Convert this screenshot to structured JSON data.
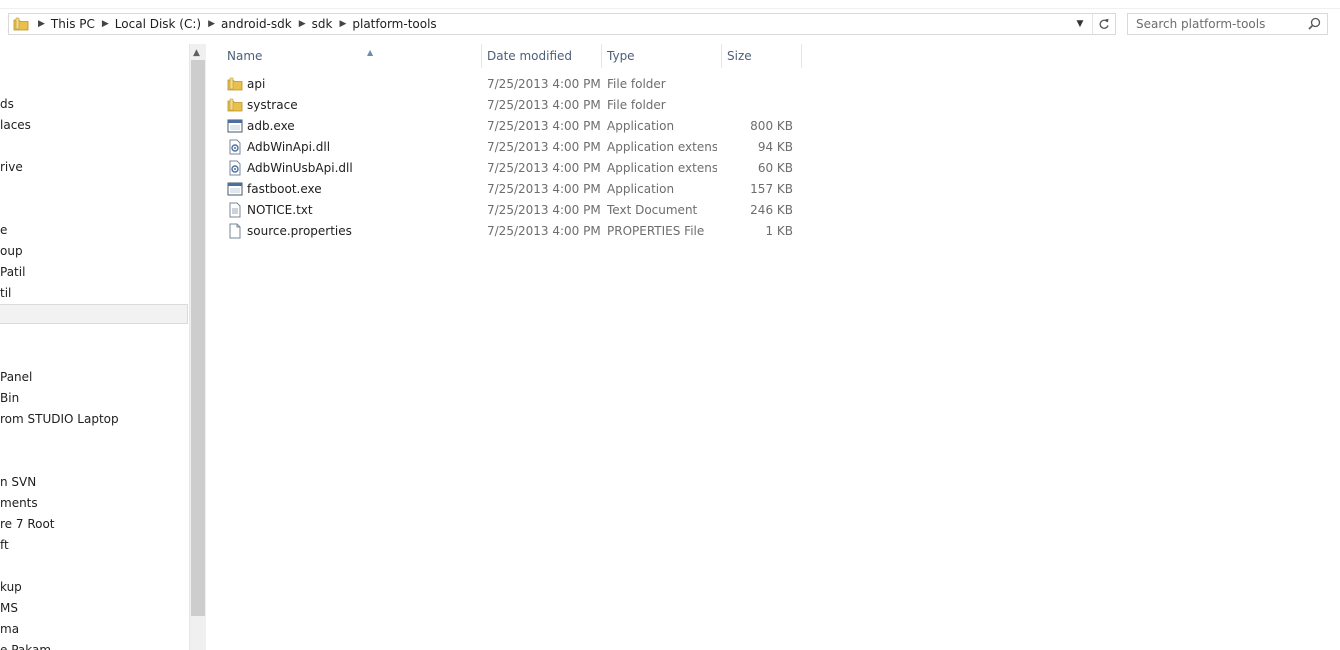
{
  "address_bar": {
    "crumbs": [
      "This PC",
      "Local Disk (C:)",
      "android-sdk",
      "sdk",
      "platform-tools"
    ]
  },
  "search": {
    "placeholder": "Search platform-tools"
  },
  "nav_pane": {
    "items": [
      "ds",
      "laces",
      "rive",
      "e",
      "oup",
      "Patil",
      "til",
      "Panel",
      "Bin",
      "rom STUDIO Laptop",
      "n SVN",
      "ments",
      "re 7 Root",
      "ft",
      "kup",
      "MS",
      "ma",
      "e Pakam"
    ]
  },
  "file_list": {
    "columns": {
      "name": "Name",
      "date": "Date modified",
      "type": "Type",
      "size": "Size"
    },
    "sort_column": "Name",
    "files": [
      {
        "name": "api",
        "date": "7/25/2013 4:00 PM",
        "type": "File folder",
        "size": "",
        "icon": "folder-icon"
      },
      {
        "name": "systrace",
        "date": "7/25/2013 4:00 PM",
        "type": "File folder",
        "size": "",
        "icon": "folder-icon"
      },
      {
        "name": "adb.exe",
        "date": "7/25/2013 4:00 PM",
        "type": "Application",
        "size": "800 KB",
        "icon": "application-icon"
      },
      {
        "name": "AdbWinApi.dll",
        "date": "7/25/2013 4:00 PM",
        "type": "Application extens...",
        "size": "94 KB",
        "icon": "dll-icon"
      },
      {
        "name": "AdbWinUsbApi.dll",
        "date": "7/25/2013 4:00 PM",
        "type": "Application extens...",
        "size": "60 KB",
        "icon": "dll-icon"
      },
      {
        "name": "fastboot.exe",
        "date": "7/25/2013 4:00 PM",
        "type": "Application",
        "size": "157 KB",
        "icon": "application-icon"
      },
      {
        "name": "NOTICE.txt",
        "date": "7/25/2013 4:00 PM",
        "type": "Text Document",
        "size": "246 KB",
        "icon": "text-file-icon"
      },
      {
        "name": "source.properties",
        "date": "7/25/2013 4:00 PM",
        "type": "PROPERTIES File",
        "size": "1 KB",
        "icon": "file-icon"
      }
    ]
  },
  "colors": {
    "header_text": "#4c607a",
    "folder_yellow": "#e8c04a",
    "selection_bg": "#f2f2f2"
  }
}
